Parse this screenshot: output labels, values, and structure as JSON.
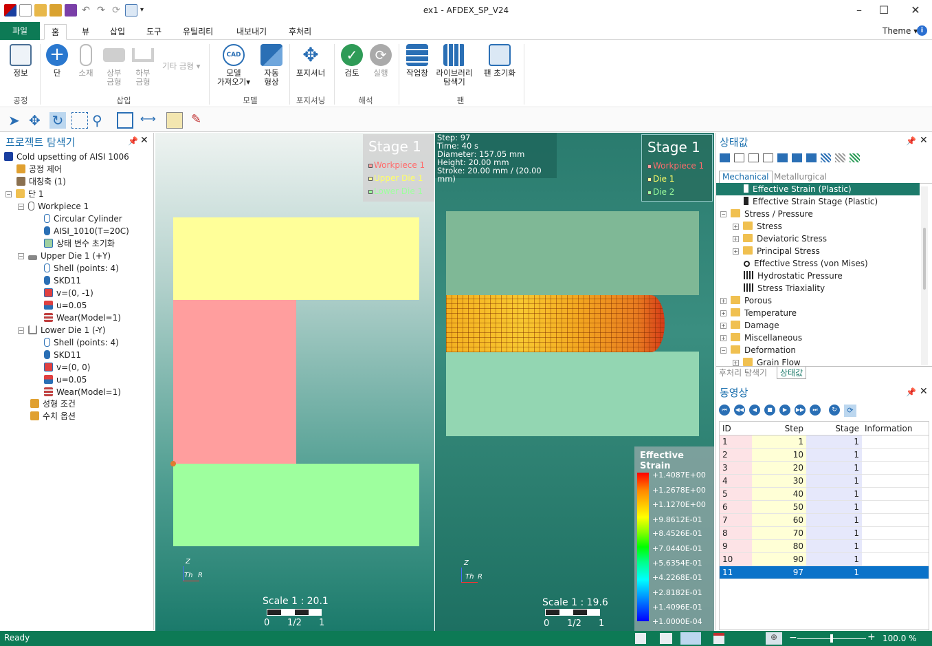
{
  "window": {
    "title": "ex1 - AFDEX_SP_V24"
  },
  "ribbon": {
    "file_tab": "파일",
    "tabs": [
      "홈",
      "뷰",
      "삽입",
      "도구",
      "유틸리티",
      "내보내기",
      "후처리"
    ],
    "theme_label": "Theme",
    "buttons": {
      "info": "정보",
      "stage": "단",
      "material": "소재",
      "upper_die_1": "상부",
      "upper_die_2": "금형",
      "lower_die_1": "하부",
      "lower_die_2": "금형",
      "other_die": "기타 금형",
      "model_import_1": "모델",
      "model_import_2": "가져오기",
      "auto_shape_1": "자동",
      "auto_shape_2": "형상",
      "positioner": "포지셔너",
      "check": "검토",
      "run": "실행",
      "workspace": "작업창",
      "library_1": "라이브러리",
      "library_2": "탐색기",
      "pane_reset": "팬 초기화",
      "cad_badge": "CAD"
    },
    "groups": {
      "process": "공정",
      "insert": "삽입",
      "model": "모델",
      "positioning": "포지셔닝",
      "analysis": "해석",
      "pane": "팬"
    }
  },
  "project_explorer": {
    "title": "프로젝트 탐색기",
    "items": {
      "root": "Cold upsetting of AISI 1006",
      "process_control": "공정 제어",
      "symmetry_axis": "대칭축 (1)",
      "stage1": "단 1",
      "workpiece1": "Workpiece 1",
      "circular_cylinder": "Circular Cylinder",
      "aisi": "AISI_1010(T=20C)",
      "state_init": "상태 변수 초기화",
      "upper_die": "Upper Die 1 (+Y)",
      "ud_shell": "Shell (points: 4)",
      "ud_mat": "SKD11",
      "ud_v": "v=(0, -1)",
      "ud_u": "u=0.05",
      "ud_wear": "Wear(Model=1)",
      "lower_die": "Lower Die 1 (-Y)",
      "ld_shell": "Shell (points: 4)",
      "ld_mat": "SKD11",
      "ld_v": "v=(0, 0)",
      "ld_u": "u=0.05",
      "ld_wear": "Wear(Model=1)",
      "forming_cond": "성형 조건",
      "numeric_opt": "수치 옵션"
    }
  },
  "viewport_left": {
    "stage_title": "Stage 1",
    "legend": [
      "Workpiece 1",
      "Upper Die 1",
      "Lower Die 1"
    ],
    "scale": "Scale 1 : 20.1",
    "scale_ticks": [
      "0",
      "1/2",
      "1"
    ],
    "axes": {
      "z": "Z",
      "th": "Th",
      "r": "R"
    }
  },
  "viewport_right": {
    "info": [
      "Step: 97",
      "Time: 40 s",
      "Diameter: 157.05 mm",
      "Height: 20.00 mm",
      "Stroke: 20.00 mm / (20.00 mm)"
    ],
    "stage_title": "Stage 1",
    "legend": [
      "Workpiece 1",
      "Die 1",
      "Die 2"
    ],
    "scale": "Scale 1 : 19.6",
    "scale_ticks": [
      "0",
      "1/2",
      "1"
    ],
    "axes": {
      "z": "Z",
      "th": "Th",
      "r": "R"
    },
    "contour_title": "Effective Strain",
    "contour_values": [
      "+1.4087E+00",
      "+1.2678E+00",
      "+1.1270E+00",
      "+9.8612E-01",
      "+8.4526E-01",
      "+7.0440E-01",
      "+5.6354E-01",
      "+4.2268E-01",
      "+2.8182E-01",
      "+1.4096E-01",
      "+1.0000E-04"
    ]
  },
  "state_panel": {
    "title": "상태값",
    "tabs": [
      "Mechanical",
      "Metallurgical"
    ],
    "items": {
      "eff_strain": "Effective Strain (Plastic)",
      "eff_strain_stage": "Effective Strain Stage (Plastic)",
      "stress_pressure": "Stress / Pressure",
      "stress": "Stress",
      "deviatoric": "Deviatoric Stress",
      "principal": "Principal Stress",
      "von_mises": "Effective Stress (von Mises)",
      "hydrostatic": "Hydrostatic Pressure",
      "triaxiality": "Stress Triaxiality",
      "porous": "Porous",
      "temperature": "Temperature",
      "damage": "Damage",
      "misc": "Miscellaneous",
      "deformation": "Deformation",
      "grain_flow": "Grain Flow"
    },
    "bottom_tabs": [
      "후처리 탐색기",
      "상태값"
    ]
  },
  "video_panel": {
    "title": "동영상",
    "columns": [
      "ID",
      "Step",
      "Stage",
      "Information"
    ],
    "rows": [
      [
        "1",
        "1",
        "1",
        ""
      ],
      [
        "2",
        "10",
        "1",
        ""
      ],
      [
        "3",
        "20",
        "1",
        ""
      ],
      [
        "4",
        "30",
        "1",
        ""
      ],
      [
        "5",
        "40",
        "1",
        ""
      ],
      [
        "6",
        "50",
        "1",
        ""
      ],
      [
        "7",
        "60",
        "1",
        ""
      ],
      [
        "8",
        "70",
        "1",
        ""
      ],
      [
        "9",
        "80",
        "1",
        ""
      ],
      [
        "10",
        "90",
        "1",
        ""
      ],
      [
        "11",
        "97",
        "1",
        ""
      ]
    ]
  },
  "status": {
    "ready": "Ready",
    "zoom": "100.0 %",
    "zoom_fraction": 0.5
  },
  "colors": {
    "accent": "#0d7a55",
    "selected_row": "#0a72c9",
    "highlight_tree": "#1d7a6a"
  }
}
